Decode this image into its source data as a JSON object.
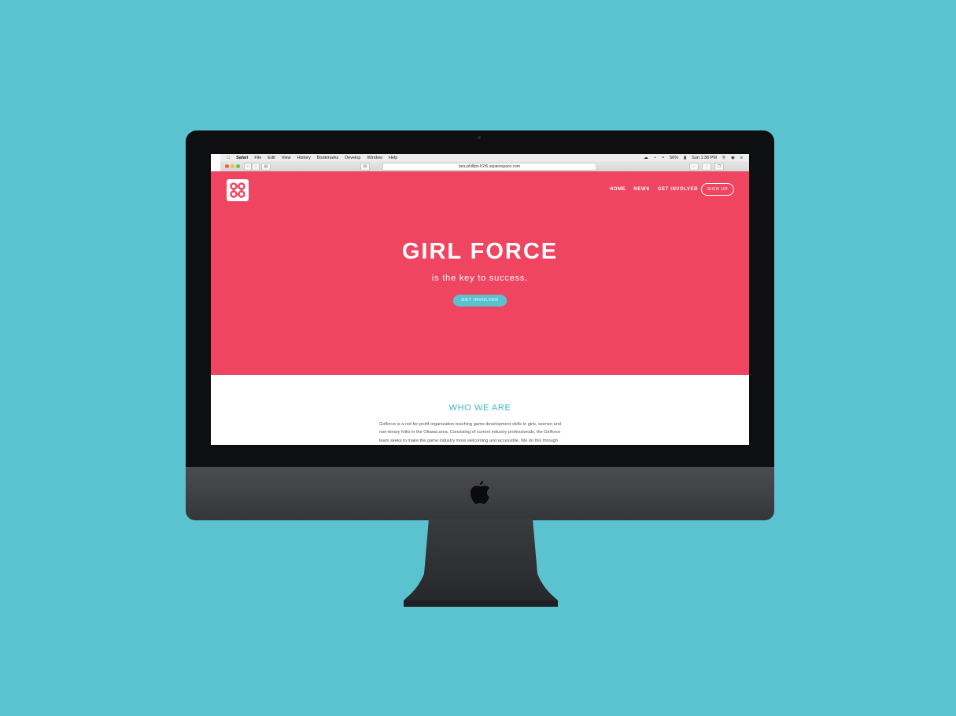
{
  "colors": {
    "background": "#5bc3cf",
    "hero": "#ef4560",
    "accent": "#58c3cf",
    "heading_teal": "#3fb8c9"
  },
  "mac_menubar": {
    "apple_icon": "apple-icon",
    "items": [
      "Safari",
      "File",
      "Edit",
      "View",
      "History",
      "Bookmarks",
      "Develop",
      "Window",
      "Help"
    ],
    "battery": "56%",
    "clock": "Sun 1:36 PM"
  },
  "browser": {
    "url": "tara-phillips-lr2r6.squarespace.com"
  },
  "site": {
    "logo_icon": "command-key-icon",
    "nav": [
      "HOME",
      "NEWS",
      "GET INVOLVED"
    ],
    "signup_label": "SIGN UP",
    "hero_title": "GIRL FORCE",
    "hero_subtitle": "is the key to success.",
    "hero_button": "GET INVOLVED",
    "section_title": "WHO WE ARE",
    "section_lines": [
      "Girlforce is a not-for-profit organization teaching game development skills to girls, women and",
      "non-binary folks in the Ottawa area. Consisting of current industry professionals, the Girlforce",
      "team seeks to make the game industry more welcoming and accessible. We do this through"
    ]
  }
}
